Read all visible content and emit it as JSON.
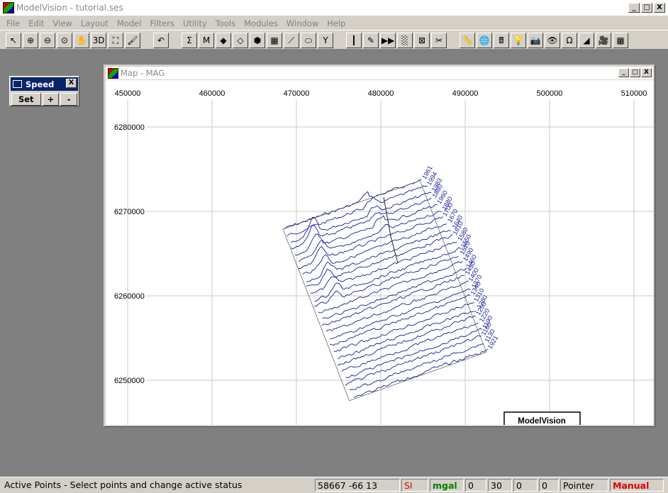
{
  "app": {
    "title": "ModelVision - tutorial.ses",
    "controls": [
      "_",
      "□",
      "X"
    ]
  },
  "menu": [
    "File",
    "Edit",
    "View",
    "Layout",
    "Model",
    "Filters",
    "Utility",
    "Tools",
    "Modules",
    "Window",
    "Help"
  ],
  "toolbar": {
    "icons": [
      "pointer-icon",
      "zoom-in-icon",
      "zoom-out-icon",
      "zoom-extent-icon",
      "pan-hand-icon",
      "3d-view-icon",
      "fit-window-icon",
      "paint-brush-icon",
      "undo-icon",
      "sum-icon",
      "model-body-icon",
      "polygon-icon",
      "edit-polygon-icon",
      "node-icon",
      "grid-icon",
      "profile-icon",
      "cylinder-icon",
      "magnet-body-icon",
      "profile-lines-icon",
      "draw-line-icon",
      "forward-icon",
      "dot-grid-icon",
      "cross-grid-icon",
      "cut-icon",
      "ruler-icon",
      "globe-icon",
      "calculator-icon",
      "light-bulb-icon",
      "camera-icon",
      "eye-icon",
      "magnet-icon",
      "shape-icon",
      "movie-icon",
      "table-icon"
    ],
    "glyphs": [
      "↖",
      "⊕",
      "⊖",
      "⊙",
      "✋",
      "3D",
      "⛶",
      "🖌",
      "↶",
      "Σ",
      "M",
      "◆",
      "◇",
      "⬢",
      "▦",
      "⟋",
      "⬭",
      "Y",
      "┃",
      "✎",
      "▶▶",
      "░",
      "⊠",
      "✂",
      "📏",
      "🌐",
      "🖩",
      "💡",
      "📷",
      "👁",
      "Ω",
      "◢",
      "🎥",
      "▦"
    ]
  },
  "speed_panel": {
    "title": "Speed",
    "close": "X",
    "set": "Set",
    "plus": "+",
    "minus": "-"
  },
  "map_window": {
    "title": "Map - MAG",
    "controls": [
      "_",
      "□",
      "X"
    ],
    "logo_text": "ModelVision"
  },
  "chart_data": {
    "type": "line",
    "x_ticks": [
      "450000",
      "460000",
      "470000",
      "480000",
      "490000",
      "500000",
      "510000"
    ],
    "y_ticks": [
      "6280000",
      "6270000",
      "6260000",
      "6250000"
    ],
    "grid": true,
    "line_labels": [
      "1961",
      "1994",
      "1983",
      "1880",
      "1960",
      "1880",
      "1700",
      "1670",
      "1640",
      "1610",
      "1580",
      "1550",
      "1520",
      "1490",
      "1460",
      "1430",
      "1400",
      "1370",
      "1340",
      "1310",
      "1280",
      "1250",
      "1220",
      "1190",
      "1160",
      "1130",
      "1921"
    ],
    "line_color": "#1a1aa0"
  },
  "status": {
    "message": "Active Points - Select points and change active status",
    "coords": "58667   -66   13",
    "units": "SI",
    "field": "mgal",
    "v1": "0",
    "v2": "30",
    "v3": "0",
    "v4": "0",
    "tool": "Pointer",
    "mode": "Manual"
  }
}
